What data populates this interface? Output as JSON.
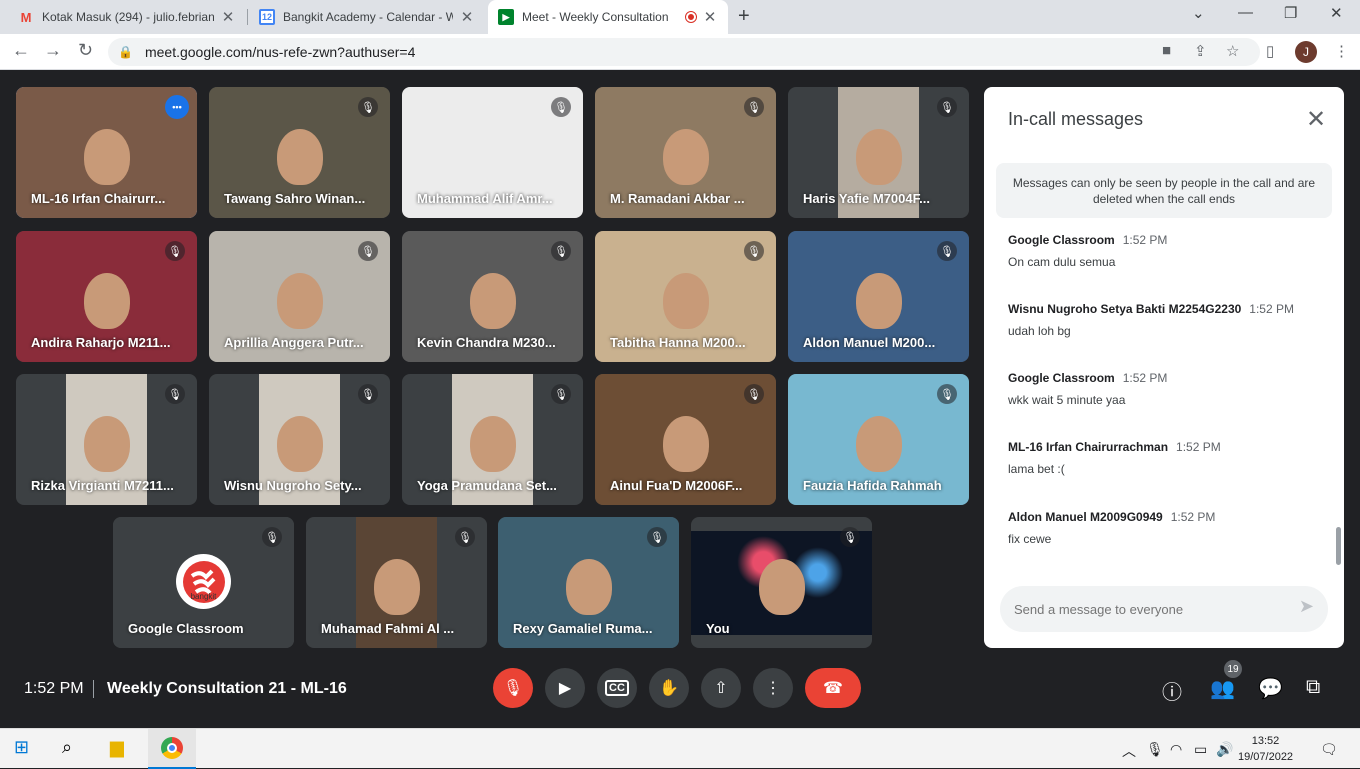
{
  "tabs": [
    {
      "title": "Kotak Masuk (294) - julio.febrian",
      "icon": "gmail-icon",
      "active": false
    },
    {
      "title": "Bangkit Academy - Calendar - W",
      "icon": "calendar-icon",
      "active": false
    },
    {
      "title": "Meet - Weekly Consultation",
      "icon": "meet-icon",
      "active": true
    }
  ],
  "calendar_favicon_text": "12",
  "address": {
    "url": "meet.google.com/nus-refe-zwn?authuser=4"
  },
  "profile_initial": "J",
  "participants": [
    {
      "name": "ML-16 Irfan Chairurr...",
      "bg": "#7a5a48"
    },
    {
      "name": "Tawang Sahro Winan...",
      "bg": "#5b5648"
    },
    {
      "name": "Muhammad Alif Amr...",
      "bg": "#ececec"
    },
    {
      "name": "M. Ramadani Akbar ...",
      "bg": "#8e7a62"
    },
    {
      "name": "Haris Yafie M7004F...",
      "bg": "#4a4a4a"
    },
    {
      "name": "Andira Raharjo M211...",
      "bg": "#8a2c3a"
    },
    {
      "name": "Aprillia Anggera Putr...",
      "bg": "#b8b4ac"
    },
    {
      "name": "Kevin Chandra M230...",
      "bg": "#5a5a5a"
    },
    {
      "name": "Tabitha Hanna M200...",
      "bg": "#c9b18f"
    },
    {
      "name": "Aldon Manuel M200...",
      "bg": "#3c5e86"
    },
    {
      "name": "Rizka Virgianti M7211...",
      "bg": "#3c4043"
    },
    {
      "name": "Wisnu Nugroho Sety...",
      "bg": "#3c4043"
    },
    {
      "name": "Yoga Pramudana Set...",
      "bg": "#3c4043"
    },
    {
      "name": "Ainul Fua'D M2006F...",
      "bg": "#6d4e35"
    },
    {
      "name": "Fauzia Hafida Rahmah",
      "bg": "#78b8d0"
    },
    {
      "name": "Google Classroom",
      "bg": "#3c4043"
    },
    {
      "name": "Muhamad Fahmi Al ...",
      "bg": "#3c4043"
    },
    {
      "name": "Rexy Gamaliel Ruma...",
      "bg": "#3d5f70"
    },
    {
      "name": "You",
      "bg": "#0d1524"
    }
  ],
  "bangkit_logo_text": "bangkit",
  "chat": {
    "title": "In-call messages",
    "notice": "Messages can only be seen by people in the call and are deleted when the call ends",
    "messages": [
      {
        "sender": "Google Classroom",
        "time": "1:52 PM",
        "text": "On cam dulu semua"
      },
      {
        "sender": "Wisnu Nugroho Setya Bakti M2254G2230",
        "time": "1:52 PM",
        "text": "udah loh bg"
      },
      {
        "sender": "Google Classroom",
        "time": "1:52 PM",
        "text": "wkk wait 5 minute yaa"
      },
      {
        "sender": "ML-16 Irfan Chairurrachman",
        "time": "1:52 PM",
        "text": "lama bet :("
      },
      {
        "sender": "Aldon Manuel M2009G0949",
        "time": "1:52 PM",
        "text": "fix cewe"
      }
    ],
    "input_placeholder": "Send a message to everyone"
  },
  "bottom": {
    "time": "1:52 PM",
    "meeting_title": "Weekly Consultation 21 - ML-16",
    "participant_count": "19"
  },
  "taskbar": {
    "time": "13:52",
    "date": "19/07/2022"
  },
  "colors": {
    "accent": "#1a73e8",
    "danger": "#ea4335",
    "background": "#202124"
  }
}
